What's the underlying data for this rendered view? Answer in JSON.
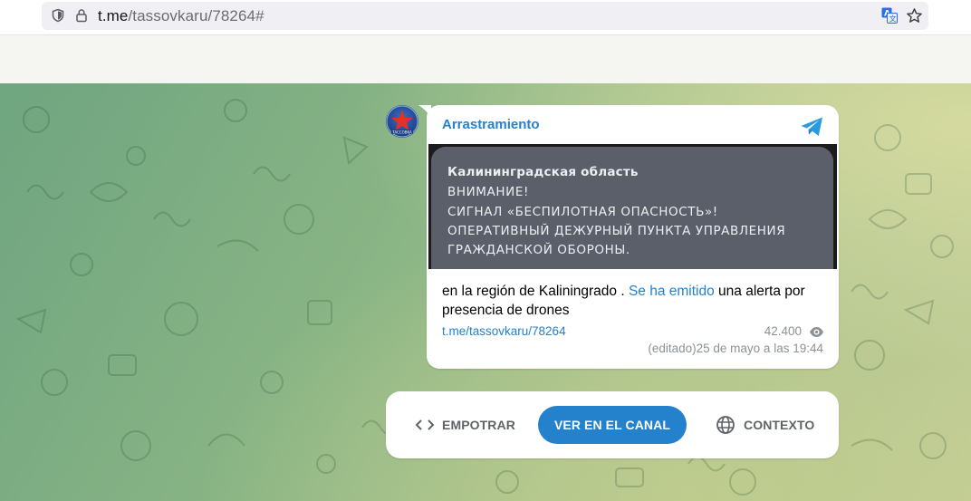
{
  "browser": {
    "url_host": "t.me",
    "url_path": "/tassovkaru/78264#"
  },
  "post": {
    "channel_name": "Arrastramiento",
    "media": {
      "lines": [
        "Калининградская область",
        "ВНИМАНИЕ!",
        "СИГНАЛ «БЕСПИЛОТНАЯ ОПАСНОСТЬ»!",
        "ОПЕРАТИВНЫЙ ДЕЖУРНЫЙ ПУНКТА УПРАВЛЕНИЯ",
        "ГРАЖДАНСКОЙ ОБОРОНЫ."
      ]
    },
    "text_before": "en la región de Kaliningrado . ",
    "text_link": "Se ha emitido",
    "text_after": " una alerta por presencia de drones",
    "link": "t.me/tassovkaru/78264",
    "views": "42.400",
    "edited_date": "(editado)25 de mayo a las 19:44"
  },
  "actions": {
    "embed_label": "EMPOTRAR",
    "view_channel_label": "VER EN EL CANAL",
    "context_label": "CONTEXTO"
  },
  "colors": {
    "accent": "#2481cc",
    "alert_card": "#5a5f69"
  },
  "icons": {
    "address_bar": [
      "shield-icon",
      "lock-icon",
      "translate-icon",
      "star-icon"
    ],
    "post": [
      "telegram-icon",
      "eye-icon"
    ],
    "actions": [
      "code-icon",
      "globe-icon"
    ]
  }
}
